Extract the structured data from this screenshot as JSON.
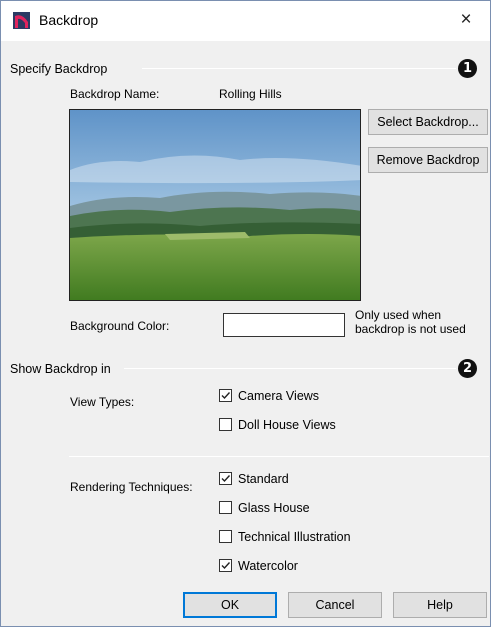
{
  "window": {
    "title": "Backdrop",
    "close_glyph": "×"
  },
  "specify": {
    "section_label": "Specify Backdrop",
    "callout": "1",
    "backdrop_name_label": "Backdrop Name:",
    "backdrop_name_value": "Rolling Hills",
    "select_button": "Select Backdrop...",
    "remove_button": "Remove Backdrop",
    "background_color_label": "Background Color:",
    "background_color_value": "#ffffff",
    "hint_line1": "Only used when",
    "hint_line2": "backdrop is not used"
  },
  "show": {
    "section_label": "Show Backdrop in",
    "callout": "2",
    "view_types_label": "View Types:",
    "view_types": [
      {
        "label": "Camera Views",
        "checked": true
      },
      {
        "label": "Doll House Views",
        "checked": false
      }
    ],
    "rendering_label": "Rendering Techniques:",
    "rendering": [
      {
        "label": "Standard",
        "checked": true
      },
      {
        "label": "Glass House",
        "checked": false
      },
      {
        "label": "Technical Illustration",
        "checked": false
      },
      {
        "label": "Watercolor",
        "checked": true
      }
    ]
  },
  "buttons": {
    "ok": "OK",
    "cancel": "Cancel",
    "help": "Help"
  }
}
